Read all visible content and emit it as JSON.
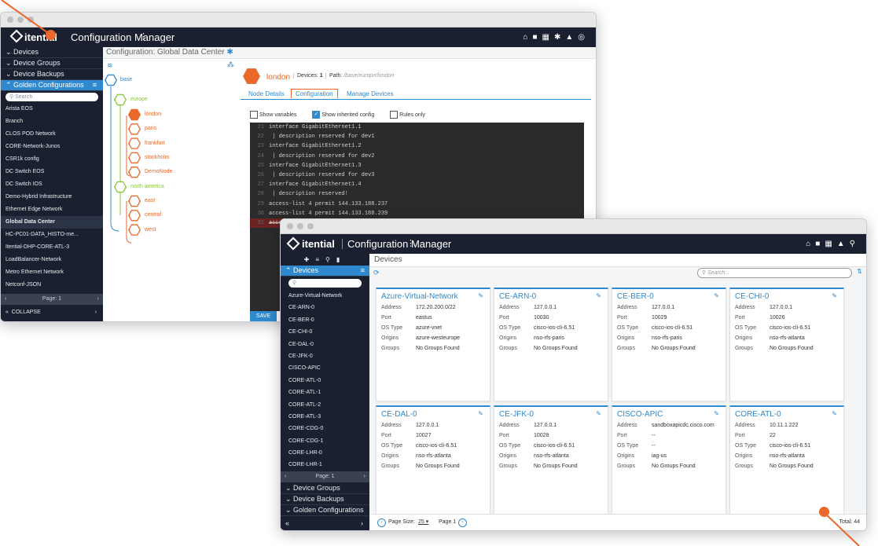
{
  "window1": {
    "app_title": "Configuration Manager",
    "brand": "itential",
    "nav": {
      "devices": "Devices",
      "device_groups": "Device Groups",
      "device_backups": "Device Backups",
      "golden_configurations": "Golden Configurations",
      "search_placeholder": "Search",
      "items": [
        "Arista EOS",
        "Branch",
        "CLOS POD Network",
        "CORE-Network-Junos",
        "CSR1k config",
        "DC Switch EOS",
        "DC Switch IOS",
        "Demo-Hybrid Infrastructure",
        "Ethernet Edge Network",
        "Global Data Center",
        "HC-PC01-DATA_HISTO-me...",
        "Itential-DHP-CORE-ATL-3",
        "LoadBalancer-Network",
        "Metro Ethernet Network",
        "Netconf-JSON"
      ],
      "selected": "Global Data Center",
      "page_label": "Page: 1",
      "collapse_label": "COLLAPSE"
    },
    "breadcrumb": "Configuration: Global Data Center",
    "tree": {
      "root": "base",
      "europe": "europe",
      "europe_children": [
        "london",
        "paris",
        "frankfurt",
        "stockholm",
        "DemoNode"
      ],
      "north_america": "north america",
      "na_children": [
        "east",
        "central",
        "west"
      ]
    },
    "node": {
      "name": "london",
      "devices_label": "Devices:",
      "devices_count": "1",
      "path_label": "Path:",
      "path_value": "/base/europe/london"
    },
    "tabs": [
      "Node Details",
      "Configuration",
      "Manage Devices"
    ],
    "active_tab": "Configuration",
    "options": {
      "show_variables": "Show variables",
      "show_inherited": "Show inherited config",
      "rules_only": "Rules only"
    },
    "code_lines": [
      {
        "n": "21",
        "t": "interface GigabitEthernet1.1"
      },
      {
        "n": "22",
        "t": " | description reserved for dev1"
      },
      {
        "n": "23",
        "t": "interface GigabitEthernet1.2"
      },
      {
        "n": "24",
        "t": " | description reserved for dev2"
      },
      {
        "n": "25",
        "t": "interface GigabitEthernet1.3"
      },
      {
        "n": "26",
        "t": " | description reserved for dev3"
      },
      {
        "n": "27",
        "t": "interface GigabitEthernet1.4"
      },
      {
        "n": "28",
        "t": " | description reserved!"
      },
      {
        "n": "29",
        "t": "access-list 4 permit 144.133.188.237"
      },
      {
        "n": "30",
        "t": "access-list 4 permit 144.133.188.239"
      },
      {
        "n": "31",
        "t": "access-list 4 permit 144.133.188.239"
      }
    ],
    "save_label": "SAVE"
  },
  "window2": {
    "app_title": "Configuration Manager",
    "brand": "itential",
    "header": "Devices",
    "search_placeholder": "Search...",
    "nav": {
      "devices": "Devices",
      "items": [
        "Azure-Virtual-Network",
        "CE-ARN-0",
        "CE-BER-0",
        "CE-CHI-0",
        "CE-DAL-0",
        "CE-JFK-0",
        "CISCO-APIC",
        "CORE-ATL-0",
        "CORE-ATL-1",
        "CORE-ATL-2",
        "CORE-ATL-3",
        "CORE-CDG-0",
        "CORE-CDG-1",
        "CORE-LHR-0",
        "CORE-LHR-1"
      ],
      "page_label": "Page: 1",
      "device_groups": "Device Groups",
      "device_backups": "Device Backups",
      "golden_configurations": "Golden Configurations"
    },
    "field_labels": {
      "address": "Address",
      "port": "Port",
      "os_type": "OS Type",
      "origins": "Origins",
      "groups": "Groups"
    },
    "cards": [
      {
        "name": "Azure-Virtual-Network",
        "address": "172.20.200.0/22",
        "port": "eastus",
        "os_type": "azure-vnet",
        "origins": "azure-westeurope",
        "groups": "No Groups Found"
      },
      {
        "name": "CE-ARN-0",
        "address": "127.0.0.1",
        "port": "10030",
        "os_type": "cisco-ios-cli-6.51",
        "origins": "nso-rfs-paris",
        "groups": "No Groups Found"
      },
      {
        "name": "CE-BER-0",
        "address": "127.0.0.1",
        "port": "10029",
        "os_type": "cisco-ios-cli-6.51",
        "origins": "nso-rfs-paris",
        "groups": "No Groups Found"
      },
      {
        "name": "CE-CHI-0",
        "address": "127.0.0.1",
        "port": "10026",
        "os_type": "cisco-ios-cli-6.51",
        "origins": "nso-rfs-atlanta",
        "groups": "No Groups Found"
      },
      {
        "name": "CE-DAL-0",
        "address": "127.0.0.1",
        "port": "10027",
        "os_type": "cisco-ios-cli-6.51",
        "origins": "nso-rfs-atlanta",
        "groups": "No Groups Found"
      },
      {
        "name": "CE-JFK-0",
        "address": "127.0.0.1",
        "port": "10028",
        "os_type": "cisco-ios-cli-6.51",
        "origins": "nso-rfs-atlanta",
        "groups": "No Groups Found"
      },
      {
        "name": "CISCO-APIC",
        "address": "sandboxapicdc.cisco.com",
        "port": "--",
        "os_type": "--",
        "origins": "iag-us",
        "groups": "No Groups Found"
      },
      {
        "name": "CORE-ATL-0",
        "address": "10.11.1.222",
        "port": "22",
        "os_type": "cisco-ios-cli-6.51",
        "origins": "nso-rfs-atlanta",
        "groups": "No Groups Found"
      }
    ],
    "footer": {
      "page_size_label": "Page Size:",
      "page_size": "25",
      "page_label": "Page 1",
      "total": "Total: 44"
    }
  },
  "colors": {
    "accent": "#2f89cf",
    "orange": "#e8692a",
    "nav_bg": "#1b2030",
    "tree_green": "#8cc63f"
  }
}
